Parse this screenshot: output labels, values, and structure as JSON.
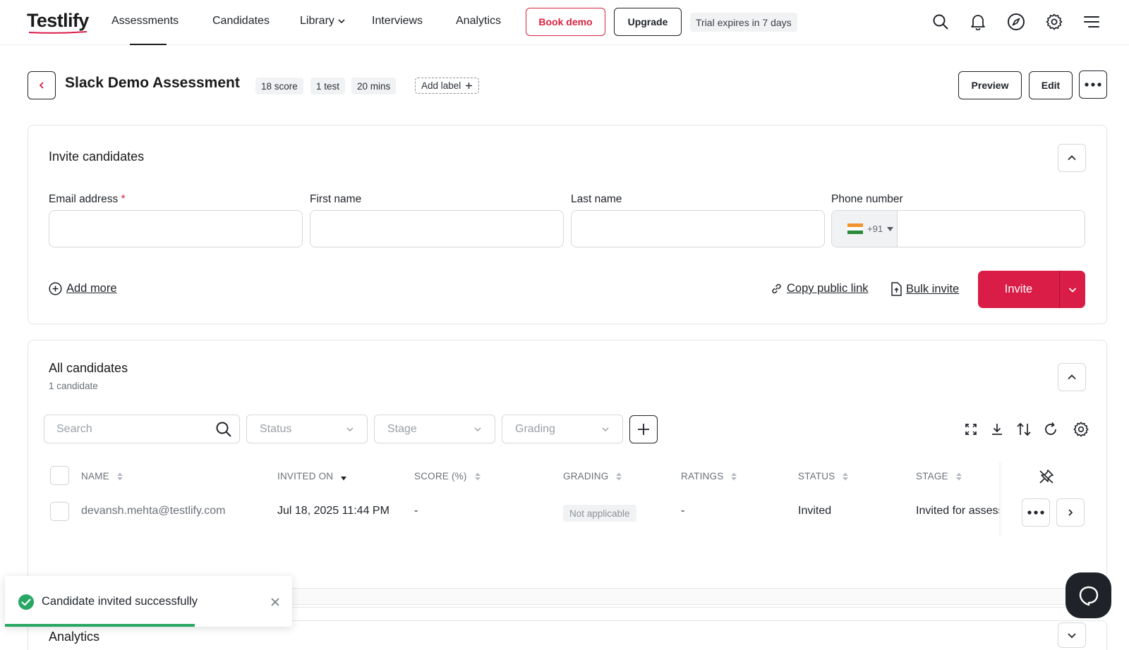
{
  "brand": {
    "logo_text": "Testlify",
    "accent": "#d91d47"
  },
  "nav": {
    "items": [
      {
        "label": "Assessments",
        "active": true
      },
      {
        "label": "Candidates"
      },
      {
        "label": "Library",
        "has_dropdown": true
      },
      {
        "label": "Interviews"
      },
      {
        "label": "Analytics"
      }
    ],
    "book_demo_label": "Book demo",
    "upgrade_label": "Upgrade",
    "trial_text": "Trial expires in 7 days",
    "icons": [
      "search-icon",
      "bell-icon",
      "compass-icon",
      "gear-icon",
      "menu-icon"
    ]
  },
  "assessment": {
    "title": "Slack Demo Assessment",
    "meta": [
      "18 score",
      "1 test",
      "20 mins"
    ],
    "add_label": "Add label",
    "preview_label": "Preview",
    "edit_label": "Edit"
  },
  "invite": {
    "title": "Invite candidates",
    "fields": {
      "email_label": "Email address",
      "email_required_mark": "*",
      "first_name_label": "First name",
      "last_name_label": "Last name",
      "phone_label": "Phone number",
      "country_code": "+91",
      "email_value": "",
      "first_name_value": "",
      "last_name_value": "",
      "phone_value": ""
    },
    "add_more": "Add more",
    "copy_public_link": "Copy public link",
    "bulk_invite": "Bulk invite",
    "invite_button": "Invite"
  },
  "candidates": {
    "title": "All candidates",
    "count_text": "1 candidate",
    "search_placeholder": "Search",
    "filters": {
      "status": "Status",
      "stage": "Stage",
      "grading": "Grading"
    },
    "columns": [
      "NAME",
      "INVITED ON",
      "SCORE (%)",
      "GRADING",
      "RATINGS",
      "STATUS",
      "STAGE"
    ],
    "rows": [
      {
        "name": "devansh.mehta@testlify.com",
        "invited_on": "Jul 18, 2025 11:44 PM",
        "score": "-",
        "grading": "Not applicable",
        "ratings": "-",
        "status": "Invited",
        "stage": "Invited for assessment"
      }
    ]
  },
  "analytics": {
    "title": "Analytics"
  },
  "toast": {
    "message": "Candidate invited successfully",
    "progress": 0.66,
    "color": "#28a764"
  }
}
